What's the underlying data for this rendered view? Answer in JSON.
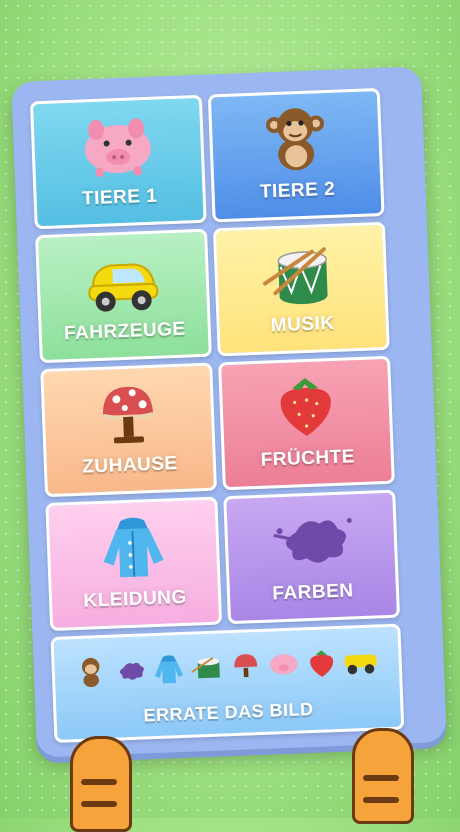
{
  "menu": {
    "tiles": [
      {
        "label": "TIERE 1"
      },
      {
        "label": "TIERE 2"
      },
      {
        "label": "FAHRZEUGE"
      },
      {
        "label": "MUSIK"
      },
      {
        "label": "ZUHAUSE"
      },
      {
        "label": "FRÜCHTE"
      },
      {
        "label": "KLEIDUNG"
      },
      {
        "label": "FARBEN"
      },
      {
        "label": "ERRATE DAS BILD"
      }
    ]
  },
  "icons": {
    "tiere1": "pig-icon",
    "tiere2": "monkey-icon",
    "fahrzeuge": "car-icon",
    "musik": "drum-icon",
    "zuhause": "lamp-icon",
    "fruchte": "strawberry-icon",
    "kleidung": "jacket-icon",
    "farben": "paint-splat-icon"
  },
  "colors": {
    "background": "#9fe082",
    "board": "#9bb6f0"
  }
}
